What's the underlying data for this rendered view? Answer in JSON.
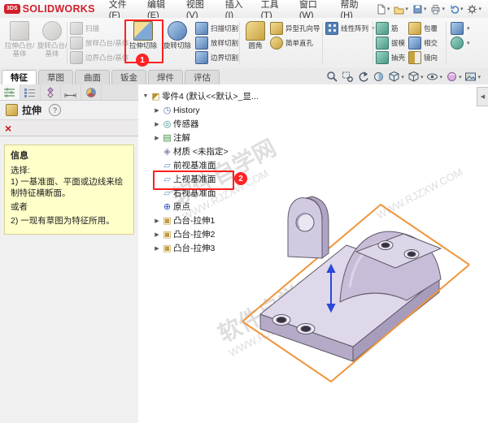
{
  "logo": {
    "badge": "3DS",
    "text": "SOLIDWORKS"
  },
  "menubar": {
    "menus": [
      "文件(F)",
      "编辑(E)",
      "视图(V)",
      "插入(I)",
      "工具(T)",
      "窗口(W)",
      "帮助(H)"
    ]
  },
  "icons": {
    "caret_down": "▾",
    "collapse_arrow": "◀"
  },
  "ribbon": {
    "extrude_boss": "拉伸凸台/基体",
    "revolve_boss": "旋转凸台/基体",
    "sweep": "扫描",
    "loft": "放样凸台/基体",
    "boundary": "边界凸台/基体",
    "extrude_cut": "拉伸切除",
    "revolve_cut": "旋转切除",
    "sweep_cut": "扫描切割",
    "loft_cut": "放样切割",
    "boundary_cut": "边界切割",
    "fillet": "圆角",
    "hole_wizard": "异型孔向导",
    "simple_hole": "简单直孔",
    "linear_pattern": "线性阵列",
    "rib": "筋",
    "draft": "拔模",
    "shell": "抽壳",
    "wrap": "包覆",
    "intersect": "相交",
    "mirror": "镜向"
  },
  "tabbar": {
    "tabs": [
      "特征",
      "草图",
      "曲面",
      "钣金",
      "焊件",
      "评估"
    ]
  },
  "property_panel": {
    "title": "拉伸",
    "help_glyph": "?",
    "close_glyph": "×",
    "info_header": "信息",
    "select_label": "选择:",
    "option1": "1) 一基准面、平面或边线来绘制特征横断面。",
    "or_label": "或者",
    "option2": "2) 一现有草图为特征所用。"
  },
  "feature_tree": {
    "items": [
      {
        "label": "零件4 (默认<<默认>_显...",
        "arrow": "▼",
        "glyph": "◩"
      },
      {
        "label": "History",
        "arrow": "▶",
        "glyph": "◷"
      },
      {
        "label": "传感器",
        "arrow": "▶",
        "glyph": "◎"
      },
      {
        "label": "注解",
        "arrow": "▶",
        "glyph": "▤"
      },
      {
        "label": "材质 <未指定>",
        "arrow": "",
        "glyph": "◈"
      },
      {
        "label": "前视基准面",
        "arrow": "",
        "glyph": "▱"
      },
      {
        "label": "上视基准面",
        "arrow": "",
        "glyph": "▱"
      },
      {
        "label": "右视基准面",
        "arrow": "",
        "glyph": "▱"
      },
      {
        "label": "原点",
        "arrow": "",
        "glyph": "⊕"
      },
      {
        "label": "凸台-拉伸1",
        "arrow": "▶",
        "glyph": "▣"
      },
      {
        "label": "凸台-拉伸2",
        "arrow": "▶",
        "glyph": "▣"
      },
      {
        "label": "凸台-拉伸3",
        "arrow": "▶",
        "glyph": "▣"
      }
    ]
  },
  "viewport": {
    "watermark_name": "软件自学网",
    "watermark_site": "WWW.RJZXW.COM"
  },
  "annotations": {
    "badge1": "1",
    "badge2": "2"
  }
}
